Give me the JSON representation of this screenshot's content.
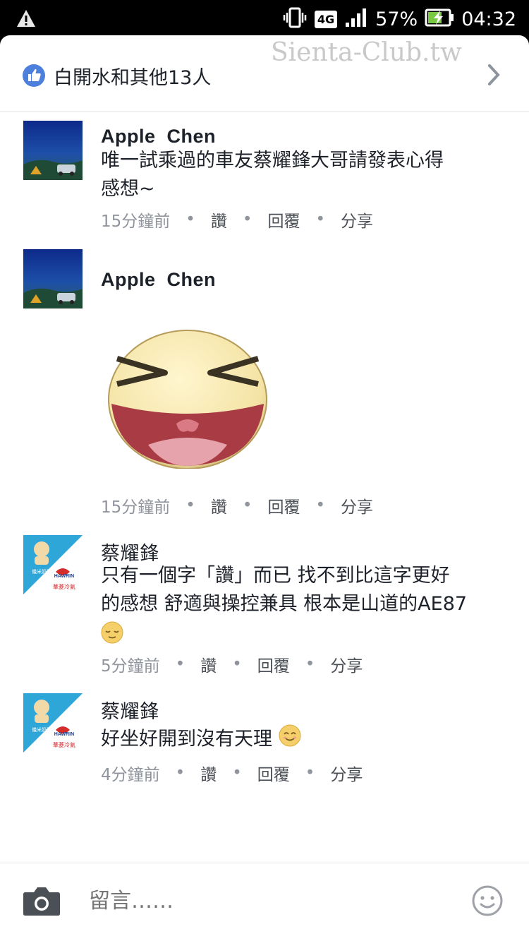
{
  "status_bar": {
    "network": "4G",
    "battery": "57%",
    "time": "04:32",
    "icons": [
      "warning-icon",
      "vibrate-icon",
      "signal-icon",
      "battery-charging-icon"
    ]
  },
  "watermark": "Sienta-Club.tw",
  "likes": {
    "text": "白開水和其他13人",
    "icon": "thumbs-up-icon",
    "chevron": "chevron-right-icon"
  },
  "comments": [
    {
      "author": "Apple  Chen",
      "text_lines": [
        "唯一試乘過的車友蔡耀鋒大哥請發表心得",
        "感想~"
      ],
      "time": "15分鐘前",
      "like": "讚",
      "reply": "回覆",
      "share": "分享"
    },
    {
      "author": "Apple  Chen",
      "sticker": "laughing-face-sticker",
      "time": "15分鐘前",
      "like": "讚",
      "reply": "回覆",
      "share": "分享"
    },
    {
      "author": "蔡耀鋒",
      "avatar_text": [
        "儀米奶酪",
        "HAWRIN",
        "華菱冷氣"
      ],
      "text_lines": [
        "只有一個字「讚」而已 找不到比這字更好",
        "的感想 舒適與操控兼具 根本是山道的AE87"
      ],
      "emoji": "relieved-face-emoji",
      "time": "5分鐘前",
      "like": "讚",
      "reply": "回覆",
      "share": "分享"
    },
    {
      "author": "蔡耀鋒",
      "avatar_text": [
        "儀米奶酪",
        "HAWRIN",
        "華菱冷氣"
      ],
      "text_lines": [
        "好坐好開到沒有天理"
      ],
      "emoji": "smiling-face-emoji",
      "time": "4分鐘前",
      "like": "讚",
      "reply": "回覆",
      "share": "分享"
    }
  ],
  "composer": {
    "placeholder": "留言……",
    "camera_icon": "camera-icon",
    "emoji_icon": "smiley-icon"
  },
  "colors": {
    "facebook_blue": "#4d7fdc",
    "text": "#1d2129",
    "meta_text": "#90949c"
  }
}
